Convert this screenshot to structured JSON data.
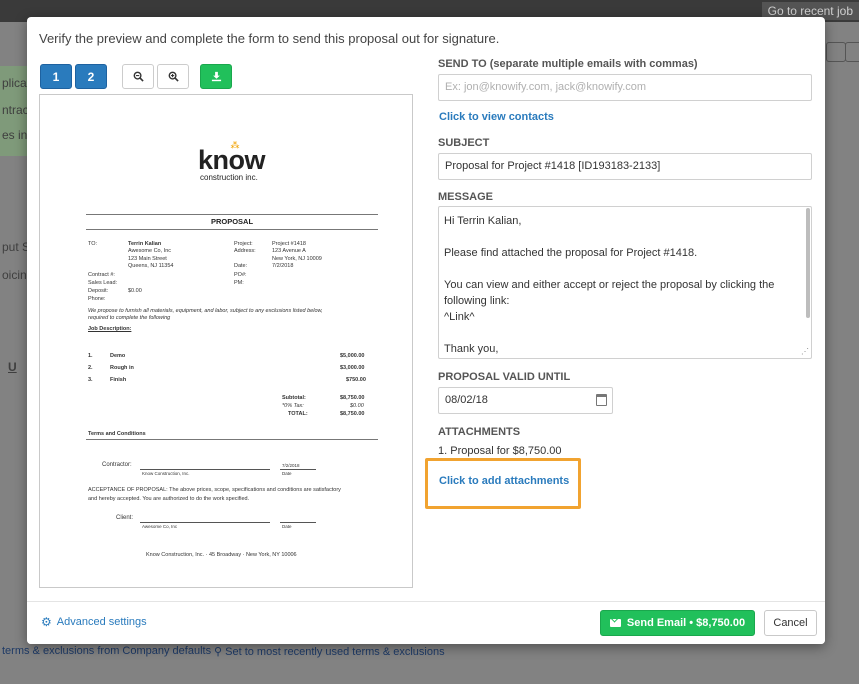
{
  "background": {
    "recent_job": "Go to recent job",
    "left_fragments": [
      "plicab",
      "ntract",
      "es in",
      "put S",
      "oicing"
    ],
    "underline": "U",
    "bottom_links": [
      "terms & exclusions from Company defaults",
      "Set to most recently used terms & exclusions"
    ]
  },
  "modal": {
    "header": "Verify the preview and complete the form to send this proposal out for signature.",
    "toolbar": {
      "page1": "1",
      "page2": "2",
      "zoom_out_icon": "zoom-out-icon",
      "zoom_in_icon": "zoom-in-icon",
      "download_icon": "download-icon"
    },
    "document": {
      "logo": "know",
      "logo_sub": "construction inc.",
      "title": "PROPOSAL",
      "to_label": "TO:",
      "client_name": "Terrin Kalian",
      "client_company": "Awesome Co, Inc",
      "client_street": "123 Main Street",
      "client_city": "Queens, NJ 11354",
      "project_label": "Project:",
      "project_value": "Project #1418",
      "address_label": "Address:",
      "address_street": "123 Avenue A",
      "address_city": "New York, NJ 10009",
      "date_label": "Date:",
      "date_value": "7/2/2018",
      "po_label": "PO#:",
      "pm_label": "PM:",
      "contract_label": "Contract #:",
      "sales_label": "Sales Lead:",
      "deposit_label": "Deposit:",
      "deposit_value": "$0.00",
      "phone_label": "Phone:",
      "intro_1": "We propose to furnish all materials, equipment, and labor, subject to any exclusions listed below,",
      "intro_2": "required to complete the following",
      "job_desc": "Job Description:",
      "items": [
        {
          "num": "1.",
          "name": "Demo",
          "amount": "$5,000.00"
        },
        {
          "num": "2.",
          "name": "Rough in",
          "amount": "$3,000.00"
        },
        {
          "num": "3.",
          "name": "Finish",
          "amount": "$750.00"
        }
      ],
      "subtotal_label": "Subtotal:",
      "subtotal_value": "$8,750.00",
      "tax_label": "*0% Tax:",
      "tax_value": "$0.00",
      "total_label": "TOTAL:",
      "total_value": "$8,750.00",
      "terms_title": "Terms and Conditions",
      "contractor_label": "Contractor:",
      "contractor_name": "Know Construction, Inc.",
      "contractor_date": "7/2/2018",
      "date_caption": "Date",
      "acceptance_1": "ACCEPTANCE OF PROPOSAL: The above prices, scope, specifications and conditions are satisfactory",
      "acceptance_2": "and hereby accepted.  You are authorized to do the work specified.",
      "client_label": "Client:",
      "client_sig_name": "Awesome Co, Inc",
      "footer": "Know Construction, Inc. · 45 Broadway · New York, NY 10006"
    },
    "form": {
      "send_to_label": "SEND TO (separate multiple emails with commas)",
      "send_to_placeholder": "Ex: jon@knowify.com, jack@knowify.com",
      "view_contacts": "Click to view contacts",
      "subject_label": "SUBJECT",
      "subject_value": "Proposal for Project #1418 [ID193183-2133]",
      "message_label": "MESSAGE",
      "message_lines": [
        "Hi Terrin Kalian,",
        "",
        "Please find attached the proposal for Project #1418.",
        "",
        "You can view and either accept or reject the proposal by clicking the",
        "following link:",
        "^Link^",
        "",
        "Thank you,"
      ],
      "valid_until_label": "PROPOSAL VALID UNTIL",
      "valid_until_value": "08/02/18",
      "calendar_icon": "calendar-icon",
      "attachments_label": "ATTACHMENTS",
      "attachment_item": "1. Proposal for $8,750.00",
      "add_attachments": "Click to add attachments"
    },
    "footer": {
      "advanced": "Advanced settings",
      "send": "Send Email • $8,750.00",
      "cancel": "Cancel"
    }
  },
  "colors": {
    "primary_blue": "#2a7bbd",
    "success_green": "#21c05b",
    "highlight_orange": "#f1a330"
  }
}
